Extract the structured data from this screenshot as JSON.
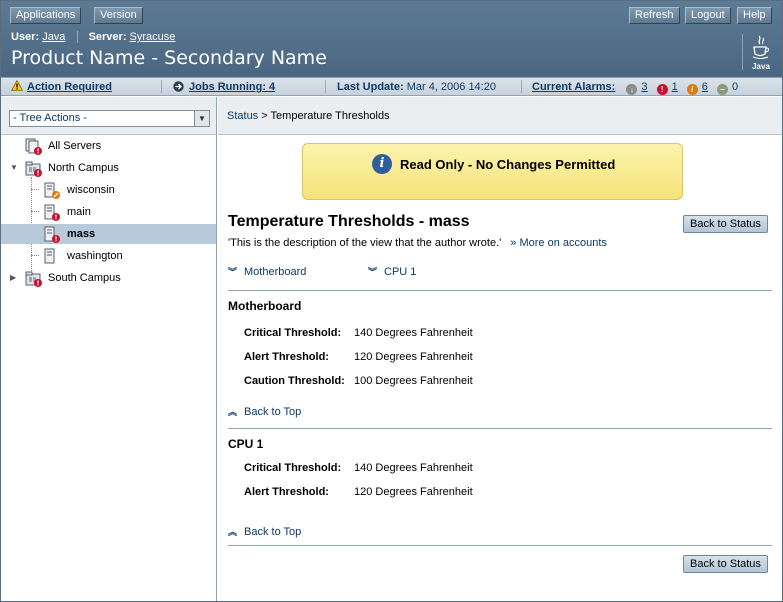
{
  "masthead": {
    "buttons_left": [
      "Applications",
      "Version"
    ],
    "buttons_right": [
      "Refresh",
      "Logout",
      "Help"
    ],
    "user_label": "User:",
    "user_value": "Java",
    "server_label": "Server:",
    "server_value": "Syracuse",
    "product_name": "Product Name - Secondary Name",
    "logo_text": "Java"
  },
  "statusbar": {
    "action_required": "Action Required",
    "jobs_running": "Jobs Running: 4",
    "last_update_label": "Last Update:",
    "last_update_value": "Mar 4, 2006 14:20",
    "current_alarms": "Current Alarms:",
    "alarms": [
      {
        "name": "down",
        "count": "3",
        "color": "#8a8a8a"
      },
      {
        "name": "critical",
        "count": "1",
        "color": "#c8102e"
      },
      {
        "name": "major",
        "count": "6",
        "color": "#e07a10"
      },
      {
        "name": "minor",
        "count": "0",
        "color": "#8c9c7a"
      }
    ]
  },
  "tree": {
    "actions_label": "- Tree Actions -",
    "items": [
      {
        "label": "All Servers"
      },
      {
        "label": "North Campus"
      },
      {
        "label": "wisconsin"
      },
      {
        "label": "main"
      },
      {
        "label": "mass"
      },
      {
        "label": "washington"
      },
      {
        "label": "South Campus"
      }
    ]
  },
  "breadcrumb": {
    "link": "Status",
    "separator": ">",
    "current": "Temperature Thresholds"
  },
  "alert": {
    "message": "Read Only - No Changes Permitted"
  },
  "page": {
    "title": "Temperature Thresholds - mass",
    "description": "'This is the description of the view that the author wrote.'",
    "more_link": "More on accounts",
    "back_button": "Back to Status",
    "jump_links": [
      "Motherboard",
      "CPU 1"
    ],
    "back_to_top": "Back to Top",
    "sections": [
      {
        "title": "Motherboard",
        "properties": [
          {
            "label": "Critical Threshold:",
            "value": "140 Degrees Fahrenheit"
          },
          {
            "label": "Alert Threshold:",
            "value": "120 Degrees Fahrenheit"
          },
          {
            "label": "Caution Threshold:",
            "value": "100 Degrees Fahrenheit"
          }
        ]
      },
      {
        "title": "CPU 1",
        "properties": [
          {
            "label": "Critical Threshold:",
            "value": "140 Degrees Fahrenheit"
          },
          {
            "label": "Alert Threshold:",
            "value": "120 Degrees Fahrenheit"
          }
        ]
      }
    ]
  },
  "colors": {
    "masthead": "#4f6b85",
    "link": "#0f3a63",
    "selected_row": "#b7c9db",
    "alert_bg": "#f8ea8c"
  }
}
